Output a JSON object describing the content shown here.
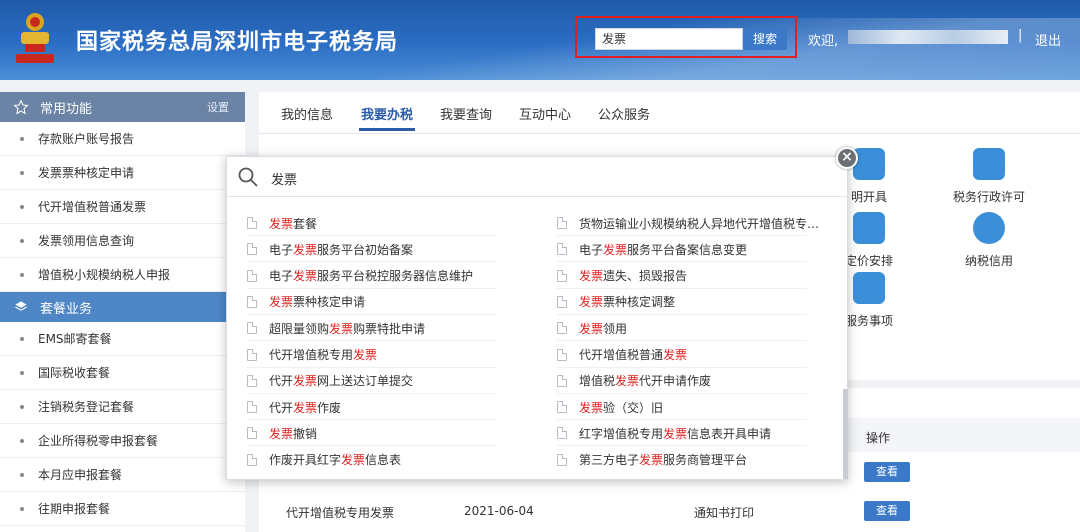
{
  "header": {
    "site_title": "国家税务总局深圳市电子税务局",
    "search_value": "发票",
    "search_button": "搜索",
    "welcome": "欢迎,",
    "separator": "|",
    "logout": "退出"
  },
  "sidebar": {
    "section1": {
      "title": "常用功能",
      "action": "设置"
    },
    "items1": [
      "存款账户账号报告",
      "发票票种核定申请",
      "代开增值税普通发票",
      "发票领用信息查询",
      "增值税小规模纳税人申报"
    ],
    "section2": {
      "title": "套餐业务"
    },
    "items2": [
      "EMS邮寄套餐",
      "国际税收套餐",
      "注销税务登记套餐",
      "企业所得税零申报套餐",
      "本月应申报套餐",
      "往期申报套餐"
    ]
  },
  "main": {
    "tabs": [
      "我的信息",
      "我要办税",
      "我要查询",
      "互动中心",
      "公众服务"
    ],
    "active_tab": 1,
    "tiles": [
      "明开具",
      "税务行政许可",
      "定价安排",
      "纳税信用",
      "服务事项"
    ],
    "table": {
      "op_header": "操作",
      "rows": [
        {
          "name": "代开增值税专用发票",
          "date": "2021-06-04",
          "action": "通知书打印",
          "op": "查看"
        }
      ],
      "partial_op": "查看"
    }
  },
  "modal": {
    "query": "发票",
    "close_symbol": "×",
    "results_left": [
      {
        "pre": "",
        "hl": "发票",
        "post": "套餐"
      },
      {
        "pre": "电子",
        "hl": "发票",
        "post": "服务平台初始备案"
      },
      {
        "pre": "电子",
        "hl": "发票",
        "post": "服务平台税控服务器信息维护"
      },
      {
        "pre": "",
        "hl": "发票",
        "post": "票种核定申请"
      },
      {
        "pre": "超限量领购",
        "hl": "发票",
        "post": "购票特批申请"
      },
      {
        "pre": "代开增值税专用",
        "hl": "发票",
        "post": ""
      },
      {
        "pre": "代开",
        "hl": "发票",
        "post": "网上送达订单提交"
      },
      {
        "pre": "代开",
        "hl": "发票",
        "post": "作废"
      },
      {
        "pre": "",
        "hl": "发票",
        "post": "撤销"
      },
      {
        "pre": "作废开具红字",
        "hl": "发票",
        "post": "信息表"
      }
    ],
    "results_right": [
      {
        "pre": "货物运输业小规模纳税人异地代开增值税专用",
        "hl": "发票",
        "post": "..."
      },
      {
        "pre": "电子",
        "hl": "发票",
        "post": "服务平台备案信息变更"
      },
      {
        "pre": "",
        "hl": "发票",
        "post": "遗失、损毁报告"
      },
      {
        "pre": "",
        "hl": "发票",
        "post": "票种核定调整"
      },
      {
        "pre": "",
        "hl": "发票",
        "post": "领用"
      },
      {
        "pre": "代开增值税普通",
        "hl": "发票",
        "post": ""
      },
      {
        "pre": "增值税",
        "hl": "发票",
        "post": "代开申请作废"
      },
      {
        "pre": "",
        "hl": "发票",
        "post": "验（交）旧"
      },
      {
        "pre": "红字增值税专用",
        "hl": "发票",
        "post": "信息表开具申请"
      },
      {
        "pre": "第三方电子",
        "hl": "发票",
        "post": "服务商管理平台"
      }
    ]
  },
  "colors": {
    "accent": "#2a5caa",
    "highlight": "#e02020",
    "header": "#2c6ec4"
  }
}
